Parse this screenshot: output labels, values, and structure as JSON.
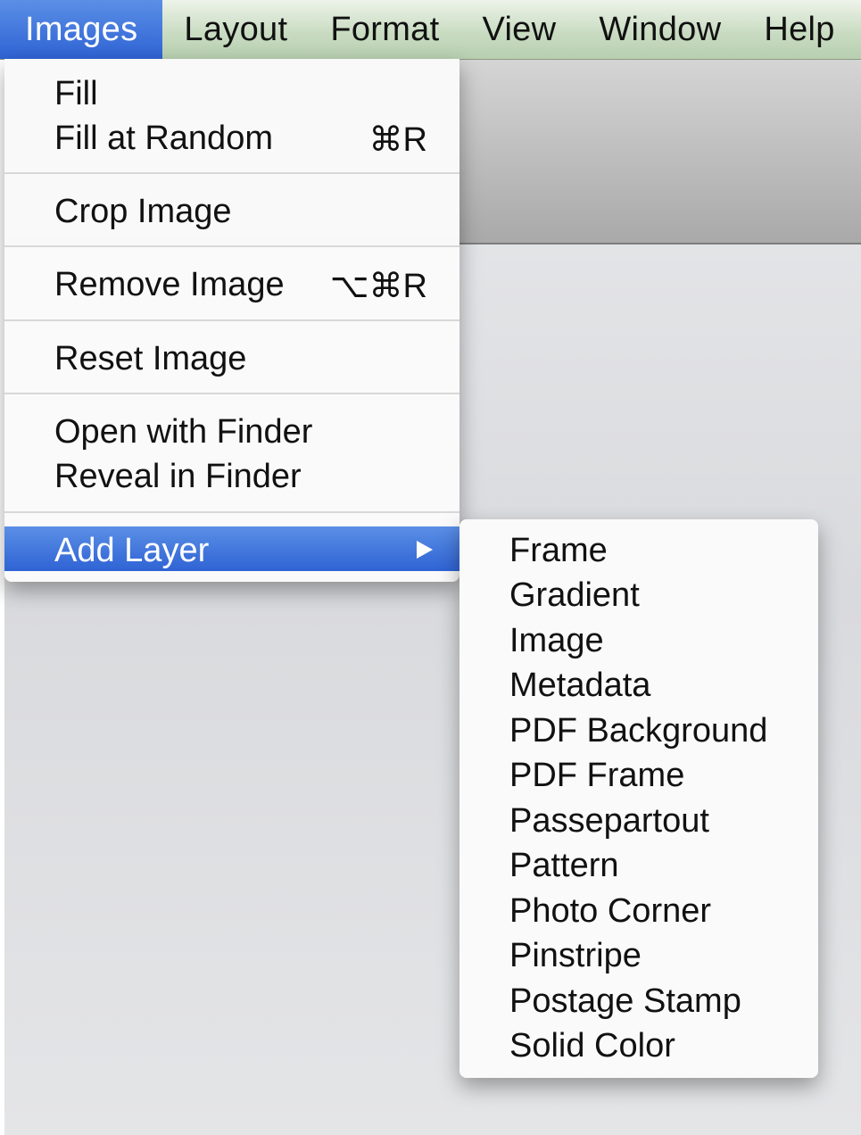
{
  "menubar": {
    "items": [
      {
        "label": "Images",
        "active": true
      },
      {
        "label": "Layout"
      },
      {
        "label": "Format"
      },
      {
        "label": "View"
      },
      {
        "label": "Window"
      },
      {
        "label": "Help"
      }
    ]
  },
  "images_menu": {
    "groups": [
      [
        {
          "label": "Fill"
        },
        {
          "label": "Fill at Random",
          "shortcut": "⌘R"
        }
      ],
      [
        {
          "label": "Crop Image"
        }
      ],
      [
        {
          "label": "Remove Image",
          "shortcut": "⌥⌘R"
        }
      ],
      [
        {
          "label": "Reset Image"
        }
      ],
      [
        {
          "label": "Open with Finder"
        },
        {
          "label": "Reveal in Finder"
        }
      ],
      [
        {
          "label": "Add Layer",
          "highlighted": true,
          "submenu_arrow_icon": "triangle-right-icon"
        }
      ]
    ]
  },
  "add_layer_submenu": {
    "items": [
      "Frame",
      "Gradient",
      "Image",
      "Metadata",
      "PDF Background",
      "PDF Frame",
      "Passepartout",
      "Pattern",
      "Photo Corner",
      "Pinstripe",
      "Postage Stamp",
      "Solid Color"
    ]
  },
  "colors": {
    "highlight": "#3a72dc",
    "menubar_bg": "#c9dcc2"
  }
}
